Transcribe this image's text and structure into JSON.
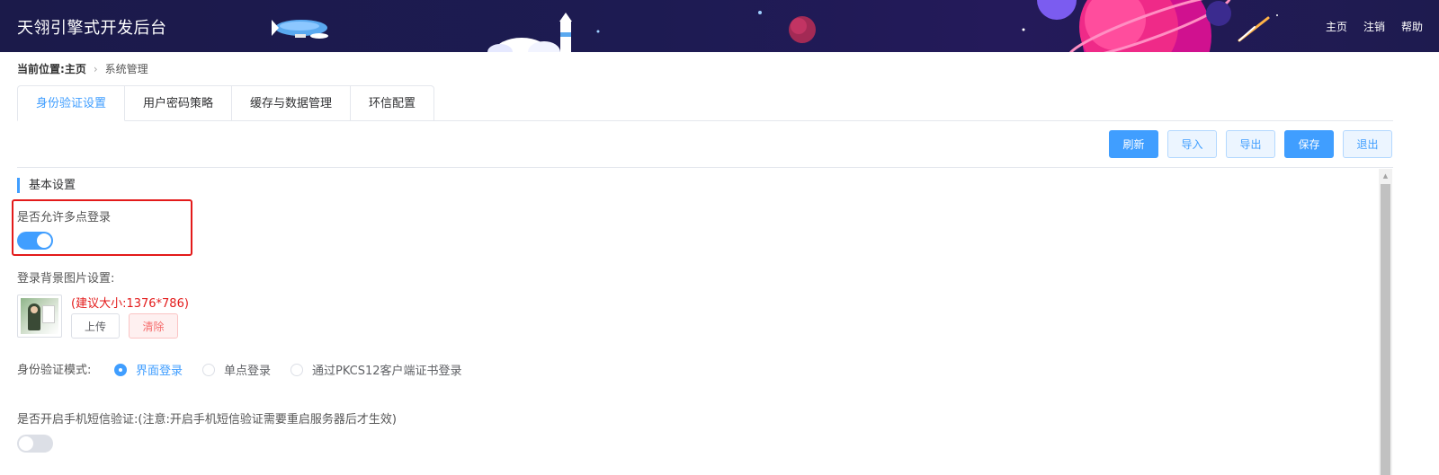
{
  "header": {
    "title": "天翎引擎式开发后台",
    "nav": [
      "主页",
      "注销",
      "帮助"
    ]
  },
  "breadcrumb": {
    "label": "当前位置:",
    "home": "主页",
    "current": "系统管理"
  },
  "tabs": [
    {
      "label": "身份验证设置",
      "active": true
    },
    {
      "label": "用户密码策略",
      "active": false
    },
    {
      "label": "缓存与数据管理",
      "active": false
    },
    {
      "label": "环信配置",
      "active": false
    }
  ],
  "toolbar": {
    "refresh": "刷新",
    "import": "导入",
    "export": "导出",
    "save": "保存",
    "exit": "退出"
  },
  "section": {
    "title": "基本设置"
  },
  "multi_login": {
    "label": "是否允许多点登录",
    "enabled": true
  },
  "bg_image": {
    "label": "登录背景图片设置:",
    "hint": "(建议大小:1376*786)",
    "upload": "上传",
    "clear": "清除"
  },
  "auth_mode": {
    "label": "身份验证模式:",
    "options": [
      "界面登录",
      "单点登录",
      "通过PKCS12客户端证书登录"
    ],
    "selected": "界面登录"
  },
  "sms_verify": {
    "label": "是否开启手机短信验证:(注意:开启手机短信验证需要重启服务器后才生效)",
    "enabled": false
  },
  "colors": {
    "primary": "#409eff",
    "header_bg": "#1d1b52",
    "highlight": "#e31a1a"
  }
}
